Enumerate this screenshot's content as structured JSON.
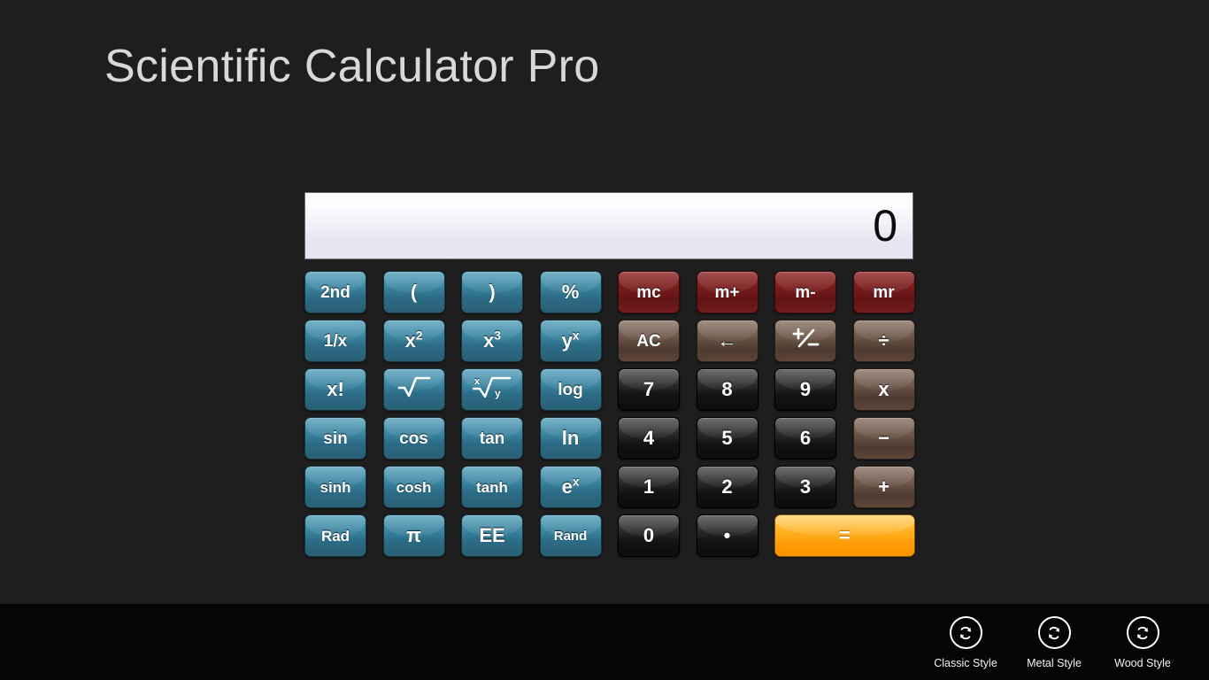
{
  "app": {
    "title": "Scientific Calculator Pro",
    "background_color": "#1e1e1e",
    "appbar_color": "#050505"
  },
  "display": {
    "value": "0",
    "placeholder": "0"
  },
  "colors": {
    "function_blue": "#3e88a3",
    "memory_red": "#7a1c1c",
    "operator_brown": "#6f594c",
    "digit_dark": "#141414",
    "equals_orange": "#ff9b06",
    "display_text": "#0d0d0d"
  },
  "keypad": {
    "rows": [
      [
        {
          "id": "second",
          "label": "2nd",
          "style": "blue",
          "size": "med"
        },
        {
          "id": "paren-open",
          "label": "(",
          "style": "blue",
          "size": "normal"
        },
        {
          "id": "paren-close",
          "label": ")",
          "style": "blue",
          "size": "normal"
        },
        {
          "id": "percent",
          "label": "%",
          "style": "blue",
          "size": "normal"
        },
        {
          "id": "mc",
          "label": "mc",
          "style": "red",
          "size": "med"
        },
        {
          "id": "m-plus",
          "label": "m+",
          "style": "red",
          "size": "med"
        },
        {
          "id": "m-minus",
          "label": "m-",
          "style": "red",
          "size": "med"
        },
        {
          "id": "mr",
          "label": "mr",
          "style": "red",
          "size": "med"
        }
      ],
      [
        {
          "id": "reciprocal",
          "label": "1/x",
          "style": "blue",
          "size": "med"
        },
        {
          "id": "x-squared",
          "label": "x2",
          "style": "blue",
          "size": "normal",
          "glyph": "sup",
          "base": "x",
          "exp": "2"
        },
        {
          "id": "x-cubed",
          "label": "x3",
          "style": "blue",
          "size": "normal",
          "glyph": "sup",
          "base": "x",
          "exp": "3"
        },
        {
          "id": "y-power-x",
          "label": "yx",
          "style": "blue",
          "size": "normal",
          "glyph": "sup",
          "base": "y",
          "exp": "x"
        },
        {
          "id": "all-clear",
          "label": "AC",
          "style": "brown",
          "size": "med"
        },
        {
          "id": "backspace",
          "label": "←",
          "style": "brown",
          "size": "normal"
        },
        {
          "id": "plus-minus",
          "label": "±",
          "style": "brown",
          "size": "normal",
          "glyph": "plusminus"
        },
        {
          "id": "divide",
          "label": "÷",
          "style": "brown",
          "size": "normal"
        }
      ],
      [
        {
          "id": "factorial",
          "label": "x!",
          "style": "blue",
          "size": "normal"
        },
        {
          "id": "square-root",
          "label": "√",
          "style": "blue",
          "size": "normal",
          "glyph": "sqrt"
        },
        {
          "id": "xth-root-y",
          "label": "x√y",
          "style": "blue",
          "size": "normal",
          "glyph": "nthroot",
          "index": "x",
          "radicand": "y"
        },
        {
          "id": "log",
          "label": "log",
          "style": "blue",
          "size": "med"
        },
        {
          "id": "digit-7",
          "label": "7",
          "style": "dark",
          "size": "normal"
        },
        {
          "id": "digit-8",
          "label": "8",
          "style": "dark",
          "size": "normal"
        },
        {
          "id": "digit-9",
          "label": "9",
          "style": "dark",
          "size": "normal"
        },
        {
          "id": "multiply",
          "label": "x",
          "style": "brown",
          "size": "normal"
        }
      ],
      [
        {
          "id": "sin",
          "label": "sin",
          "style": "blue",
          "size": "med"
        },
        {
          "id": "cos",
          "label": "cos",
          "style": "blue",
          "size": "med"
        },
        {
          "id": "tan",
          "label": "tan",
          "style": "blue",
          "size": "med"
        },
        {
          "id": "ln",
          "label": "ln",
          "style": "blue",
          "size": "normal"
        },
        {
          "id": "digit-4",
          "label": "4",
          "style": "dark",
          "size": "normal"
        },
        {
          "id": "digit-5",
          "label": "5",
          "style": "dark",
          "size": "normal"
        },
        {
          "id": "digit-6",
          "label": "6",
          "style": "dark",
          "size": "normal"
        },
        {
          "id": "subtract",
          "label": "−",
          "style": "brown",
          "size": "normal"
        }
      ],
      [
        {
          "id": "sinh",
          "label": "sinh",
          "style": "blue",
          "size": "small"
        },
        {
          "id": "cosh",
          "label": "cosh",
          "style": "blue",
          "size": "small"
        },
        {
          "id": "tanh",
          "label": "tanh",
          "style": "blue",
          "size": "small"
        },
        {
          "id": "e-power-x",
          "label": "ex",
          "style": "blue",
          "size": "normal",
          "glyph": "sup",
          "base": "e",
          "exp": "x"
        },
        {
          "id": "digit-1",
          "label": "1",
          "style": "dark",
          "size": "normal"
        },
        {
          "id": "digit-2",
          "label": "2",
          "style": "dark",
          "size": "normal"
        },
        {
          "id": "digit-3",
          "label": "3",
          "style": "dark",
          "size": "normal"
        },
        {
          "id": "add",
          "label": "+",
          "style": "brown",
          "size": "normal"
        }
      ],
      [
        {
          "id": "rad",
          "label": "Rad",
          "style": "blue",
          "size": "small"
        },
        {
          "id": "pi",
          "label": "π",
          "style": "blue",
          "size": "normal"
        },
        {
          "id": "ee",
          "label": "EE",
          "style": "blue",
          "size": "normal"
        },
        {
          "id": "rand",
          "label": "Rand",
          "style": "blue",
          "size": "xsmall"
        },
        {
          "id": "digit-0",
          "label": "0",
          "style": "dark",
          "size": "normal"
        },
        {
          "id": "decimal-point",
          "label": "•",
          "style": "dark",
          "size": "normal"
        },
        {
          "id": "equals",
          "label": "=",
          "style": "orange",
          "size": "normal",
          "wide": true
        }
      ]
    ]
  },
  "appbar": {
    "items": [
      {
        "id": "classic-style",
        "label": "Classic Style",
        "icon": "refresh-icon"
      },
      {
        "id": "metal-style",
        "label": "Metal Style",
        "icon": "refresh-icon"
      },
      {
        "id": "wood-style",
        "label": "Wood Style",
        "icon": "refresh-icon"
      }
    ]
  }
}
